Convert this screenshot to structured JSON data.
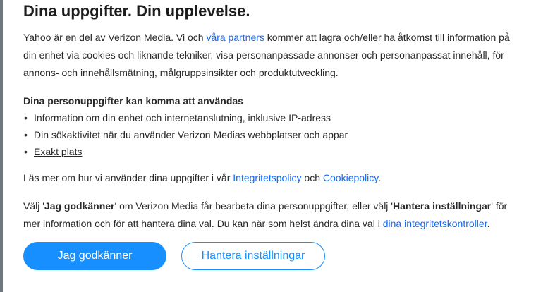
{
  "title": "Dina uppgifter. Din upplevelse.",
  "intro": {
    "t1": "Yahoo är en del av ",
    "link_verizon": "Verizon Media",
    "t2": ". Vi och ",
    "link_partners": "våra partners",
    "t3": " kommer att lagra och/eller ha åtkomst till information på din enhet via cookies och liknande tekniker, visa personanpassade annonser och personanpassat innehåll, för annons- och innehållsmätning, målgruppsinsikter och produktutveckling."
  },
  "list": {
    "title": "Dina personuppgifter kan komma att användas",
    "item1": "Information om din enhet och internetanslutning, inklusive IP-adress",
    "item2": "Din sökaktivitet när du använder Verizon Medias webbplatser och appar",
    "item3": "Exakt plats"
  },
  "readmore": {
    "t1": "Läs mer om hur vi använder dina uppgifter i vår ",
    "link_privacy": "Integritetspolicy",
    "t2": " och ",
    "link_cookie": "Cookiepolicy",
    "t3": "."
  },
  "choice": {
    "t1": "Välj '",
    "b1": "Jag godkänner",
    "t2": "' om Verizon Media får bearbeta dina personuppgifter, eller välj '",
    "b2": "Hantera inställningar",
    "t3": "' för mer information och för att hantera dina val. Du kan när som helst ändra dina val i ",
    "link_controls": "dina integritetskontroller",
    "t4": "."
  },
  "buttons": {
    "accept": "Jag godkänner",
    "manage": "Hantera inställningar"
  },
  "colors": {
    "accent": "#188fff",
    "link": "#0f69ff"
  }
}
